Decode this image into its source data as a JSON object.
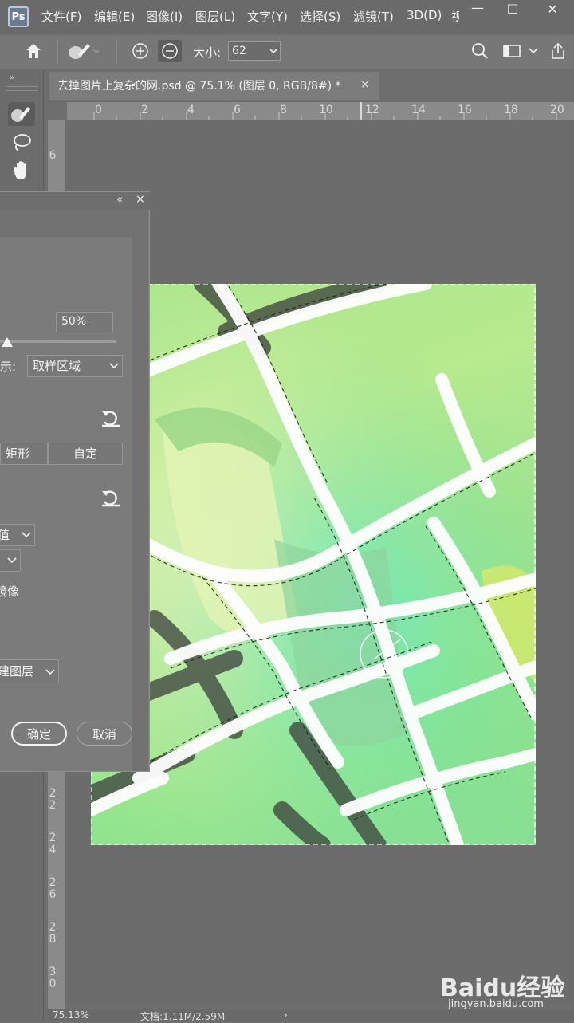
{
  "app": {
    "logo_text": "Ps"
  },
  "menu": {
    "items": [
      "文件(F)",
      "编辑(E)",
      "图像(I)",
      "图层(L)",
      "文字(Y)",
      "选择(S)",
      "滤镜(T)",
      "3D(D)",
      "视"
    ]
  },
  "window": {
    "minimize": "—",
    "maximize": "☐",
    "close": "✕"
  },
  "options": {
    "size_label": "大小:",
    "size_value": "62"
  },
  "document": {
    "tab_title": "去掉图片上复杂的网.psd @ 75.1% (图层 0, RGB/8#) *",
    "close_glyph": "×"
  },
  "ruler": {
    "h_labels": [
      "0",
      "2",
      "4",
      "6",
      "8",
      "10",
      "12",
      "14",
      "16",
      "18",
      "20"
    ],
    "v_labels": [
      "6",
      "2\n2",
      "2\n4",
      "2\n6",
      "2\n8",
      "3\n0"
    ]
  },
  "dialog": {
    "collapse": "«",
    "close": "×",
    "opacity_value": "50%",
    "display_label": "示:",
    "display_value": "取样区域",
    "rect_label": "矩形",
    "custom_label": "自定",
    "value_dd": "值",
    "mirror_label": "镜像",
    "output_value": "建图层",
    "ok_label": "确定",
    "cancel_label": "取消",
    "slider_level": 0.06
  },
  "status": {
    "zoom": "75.13%",
    "doc_info": "文档:1.11M/2.59M",
    "arrow": "›"
  },
  "watermark": {
    "logo": "Baidu经验",
    "sub": "jingyan.baidu.com"
  }
}
